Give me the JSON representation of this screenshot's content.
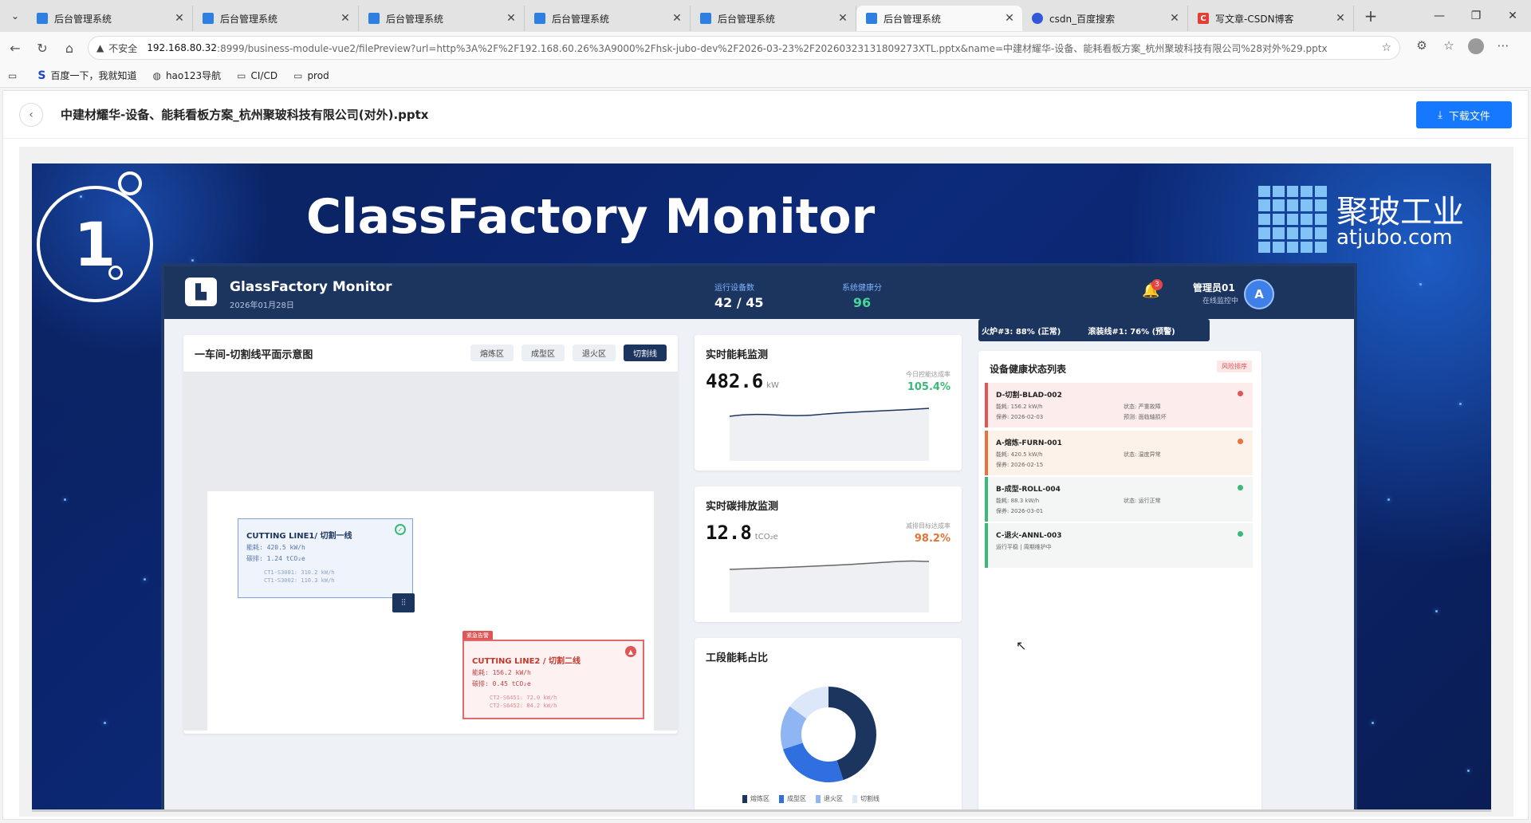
{
  "browser": {
    "tabs": [
      {
        "title": "后台管理系统",
        "type": "doc",
        "active": false
      },
      {
        "title": "后台管理系统",
        "type": "doc",
        "active": false
      },
      {
        "title": "后台管理系统",
        "type": "doc",
        "active": false
      },
      {
        "title": "后台管理系统",
        "type": "doc",
        "active": false
      },
      {
        "title": "后台管理系统",
        "type": "doc",
        "active": false
      },
      {
        "title": "后台管理系统",
        "type": "doc",
        "active": true
      },
      {
        "title": "csdn_百度搜索",
        "type": "paw",
        "active": false
      },
      {
        "title": "写文章-CSDN博客",
        "type": "csdn",
        "active": false
      }
    ],
    "address": {
      "insecure_label": "不安全",
      "host": "192.168.80.32",
      "path": ":8999/business-module-vue2/filePreview?url=http%3A%2F%2F192.168.60.26%3A9000%2Fhsk-jubo-dev%2F2026-03-23%2F20260323131809273XTL.pptx&name=中建材耀华-设备、能耗看板方案_杭州聚玻科技有限公司%28对外%29.pptx"
    },
    "bookmarks": [
      {
        "label": "百度一下，我就知道",
        "icon": "baidu-icon"
      },
      {
        "label": "hao123导航",
        "icon": "globe-icon"
      },
      {
        "label": "CI/CD",
        "icon": "folder-icon"
      },
      {
        "label": "prod",
        "icon": "folder-icon"
      }
    ]
  },
  "page": {
    "title": "中建材耀华-设备、能耗看板方案_杭州聚玻科技有限公司(对外).pptx",
    "download_label": "下载文件"
  },
  "slide": {
    "number": "1",
    "title": "ClassFactory Monitor",
    "logo_cn": "聚玻工业",
    "logo_en": "atjubo.com",
    "dashboard": {
      "name": "GlassFactory Monitor",
      "date": "2026年01月28日",
      "kpi_running_label": "运行设备数",
      "kpi_running_value": "42 / 45",
      "kpi_health_label": "系统健康分",
      "kpi_health_value": "96",
      "bell_count": "3",
      "admin_name": "管理员01",
      "admin_status": "在线监控中",
      "admin_avatar": "A",
      "floor": {
        "title": "一车间-切割线平面示意图",
        "zones": [
          "熔炼区",
          "成型区",
          "退火区",
          "切割线"
        ],
        "active_zone": "切割线",
        "line1": {
          "title": "CUTTING LINE1/ 切割一线",
          "energy": "能耗: 420.5 kW/h",
          "emission": "碳排: 1.24 tCO₂e",
          "sub1": "CT1-S3001: 310.2 kW/h",
          "sub2": "CT1-S3002: 110.3 kW/h"
        },
        "line2": {
          "tag": "紧急告警",
          "title": "CUTTING LINE2 / 切割二线",
          "energy": "能耗: 156.2 kW/h",
          "emission": "碳排: 0.45 tCO₂e",
          "sub1": "CT2-S6451: 72.0 kW/h",
          "sub2": "CT2-S6452: 84.2 kW/h"
        }
      },
      "energy": {
        "title": "实时能耗监测",
        "value": "482.6",
        "unit": "kW",
        "rate_label": "今日控能达成率",
        "rate": "105.4%"
      },
      "carbon": {
        "title": "实时碳排放监测",
        "value": "12.8",
        "unit": "tCO₂e",
        "rate_label": "减排目标达成率",
        "rate": "98.2%"
      },
      "share": {
        "title": "工段能耗占比",
        "legend": [
          "熔炼区",
          "成型区",
          "退火区",
          "切割线"
        ],
        "values": [
          45,
          25,
          15,
          15
        ],
        "colors": [
          "#1c355f",
          "#2f6fe0",
          "#8fb6f2",
          "#dce8fa"
        ]
      },
      "alerts": [
        "火炉#3: 88% (正常)",
        "滚装线#1: 76% (预警)"
      ],
      "health": {
        "title": "设备健康状态列表",
        "sort_label": "风险排序",
        "items": [
          {
            "name": "D-切割-BLAD-002",
            "energy": "能耗: 156.2 kW/h",
            "status": "状态: 严重故障",
            "maint": "保养: 2026-02-03",
            "predict": "预测: 面临轴损坏",
            "level": "danger"
          },
          {
            "name": "A-熔炼-FURN-001",
            "energy": "能耗: 420.5 kW/h",
            "status": "状态: 温度异常",
            "maint": "保养: 2026-02-15",
            "predict": "",
            "level": "warn"
          },
          {
            "name": "B-成型-ROLL-004",
            "energy": "能耗: 88.3 kW/h",
            "status": "状态: 运行正常",
            "maint": "保养: 2026-03-01",
            "predict": "",
            "level": "ok"
          },
          {
            "name": "C-退火-ANNL-003",
            "energy": "运行平稳 | 周期维护中",
            "status": "",
            "maint": "",
            "predict": "",
            "level": "ok"
          }
        ]
      }
    }
  },
  "colors": {
    "accent": "#1677ff",
    "navy": "#1c355f",
    "danger": "#e05555",
    "warn": "#e5733a",
    "ok": "#3cb878"
  }
}
